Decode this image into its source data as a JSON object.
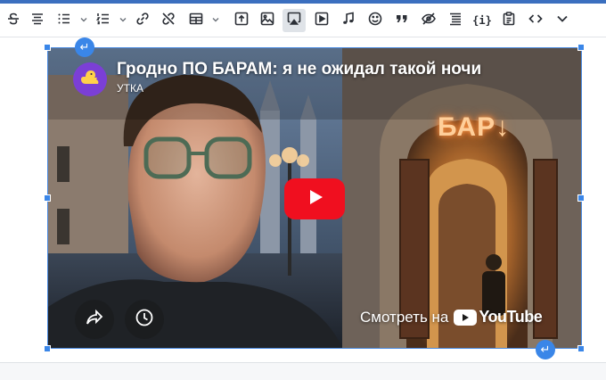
{
  "toolbar": {
    "buttons": [
      {
        "name": "strikethrough",
        "icon": "strikethrough-icon"
      },
      {
        "name": "align-center",
        "icon": "align-center-icon"
      },
      {
        "name": "bulleted-list",
        "icon": "bulleted-list-icon"
      },
      {
        "name": "numbered-list",
        "icon": "numbered-list-icon"
      },
      {
        "name": "link",
        "icon": "link-icon"
      },
      {
        "name": "unlink",
        "icon": "unlink-icon"
      },
      {
        "name": "table",
        "icon": "table-icon"
      },
      {
        "name": "upload",
        "icon": "upload-icon"
      },
      {
        "name": "image",
        "icon": "image-icon"
      },
      {
        "name": "media-embed",
        "icon": "airplay-icon",
        "active": true
      },
      {
        "name": "video",
        "icon": "play-box-icon"
      },
      {
        "name": "audio",
        "icon": "music-note-icon"
      },
      {
        "name": "emoji",
        "icon": "smiley-icon"
      },
      {
        "name": "blockquote",
        "icon": "quote-icon"
      },
      {
        "name": "hidden",
        "icon": "eye-off-icon"
      },
      {
        "name": "table-of-contents",
        "icon": "toc-icon"
      },
      {
        "name": "variables",
        "icon": "braces-icon"
      },
      {
        "name": "paste",
        "icon": "clipboard-icon"
      },
      {
        "name": "source-code",
        "icon": "code-icon"
      },
      {
        "name": "more",
        "icon": "chevron-down-icon"
      }
    ],
    "code_label": "{i}"
  },
  "embed": {
    "video_title": "Гродно ПО БАРАМ: я не ожидал такой ночи",
    "channel_name": "УТКА",
    "watch_label": "Смотреть на",
    "youtube_label": "YouTube",
    "sign_text": "БАР↓",
    "play_color": "#f00f1f",
    "selection_color": "#3a86e8"
  }
}
